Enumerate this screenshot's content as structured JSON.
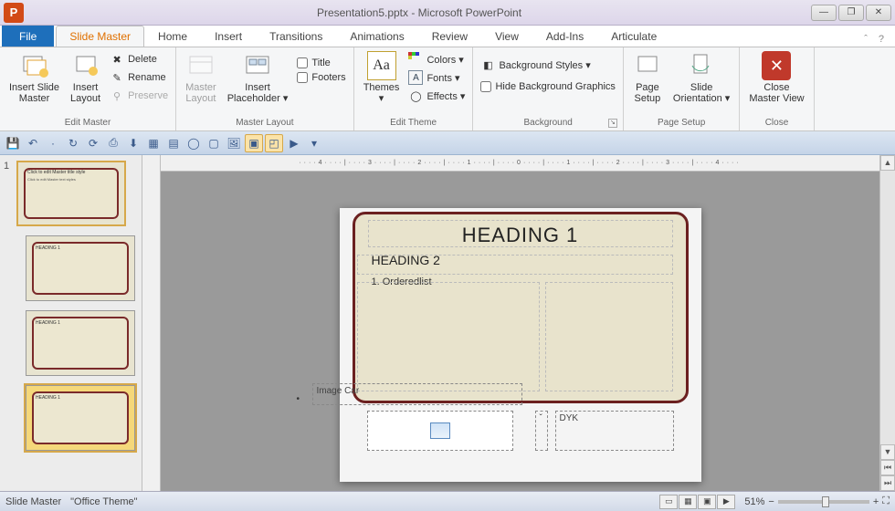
{
  "app": {
    "icon_letter": "P",
    "title": "Presentation5.pptx - Microsoft PowerPoint"
  },
  "window_buttons": {
    "min": "—",
    "max": "❐",
    "close": "✕"
  },
  "tabs": {
    "file": "File",
    "items": [
      "Slide Master",
      "Home",
      "Insert",
      "Transitions",
      "Animations",
      "Review",
      "View",
      "Add-Ins",
      "Articulate"
    ],
    "active_index": 0,
    "help": "ˆ",
    "help2": "?"
  },
  "ribbon": {
    "edit_master": {
      "label": "Edit Master",
      "insert_slide_master": "Insert Slide\nMaster",
      "insert_layout": "Insert\nLayout",
      "delete": "Delete",
      "rename": "Rename",
      "preserve": "Preserve"
    },
    "master_layout": {
      "label": "Master Layout",
      "master_layout_btn": "Master\nLayout",
      "insert_placeholder": "Insert\nPlaceholder ▾",
      "title_chk": "Title",
      "footers_chk": "Footers"
    },
    "edit_theme": {
      "label": "Edit Theme",
      "themes": "Themes\n▾",
      "colors": "Colors ▾",
      "fonts": "Fonts ▾",
      "effects": "Effects ▾"
    },
    "background": {
      "label": "Background",
      "styles": "Background Styles ▾",
      "hide": "Hide Background Graphics"
    },
    "page_setup": {
      "label": "Page Setup",
      "page_setup_btn": "Page\nSetup",
      "orientation": "Slide\nOrientation ▾"
    },
    "close": {
      "label": "Close",
      "close_btn": "Close\nMaster View"
    }
  },
  "qat": {
    "items": [
      "save",
      "undo",
      "redo",
      "refresh",
      "grid1",
      "grid2",
      "ruler",
      "grid3",
      "table",
      "circle",
      "img",
      "img2",
      "sel",
      "sel2",
      "play",
      "dd"
    ]
  },
  "ruler_marks": "····4····|····3····|····2····|····1····|····0····|····1····|····2····|····3····|····4····",
  "thumbs": {
    "num": "1"
  },
  "slide": {
    "h1": "HEADING 1",
    "h2": "HEADING 2",
    "ol_item": "1.  Orderedlist",
    "image_car_label": "Image Car",
    "bullet": "•",
    "dyk_caret": "ˇ",
    "dyk": "DYK"
  },
  "status": {
    "mode": "Slide Master",
    "theme": "\"Office Theme\"",
    "zoom_pct": "51%",
    "zoom_minus": "−",
    "zoom_plus": "+",
    "fit": "⛶"
  }
}
